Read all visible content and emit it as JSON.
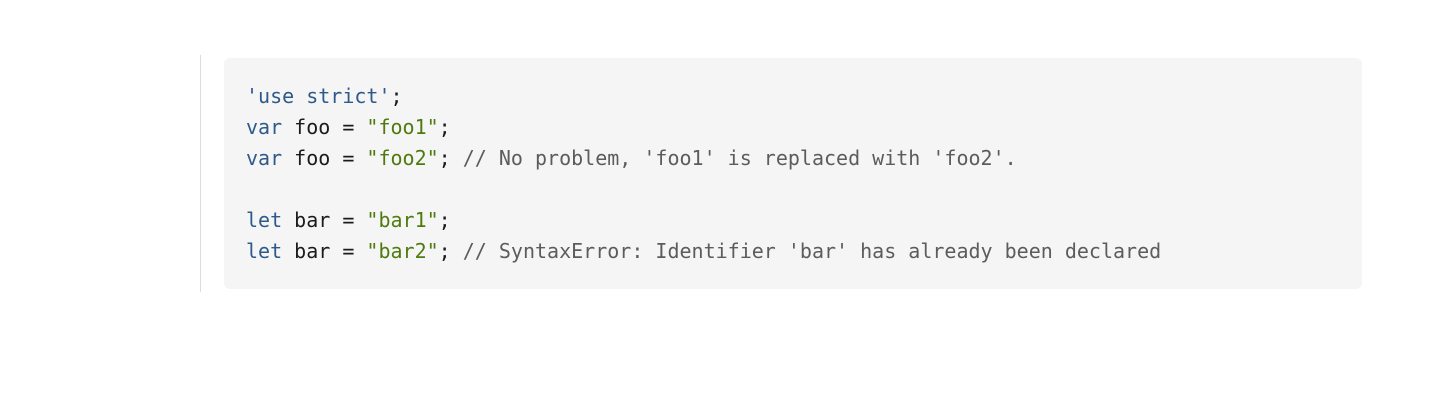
{
  "colors": {
    "background": "#ffffff",
    "code_background": "#f5f5f5",
    "keyword": "#2e5a8a",
    "string": "#4f7a0e",
    "comment": "#5c5c5c",
    "text": "#1b1b1b"
  },
  "code": {
    "lines": [
      [
        {
          "t": "'use strict'",
          "k": "string-single"
        },
        {
          "t": ";",
          "k": "plain"
        }
      ],
      [
        {
          "t": "var",
          "k": "keyword"
        },
        {
          "t": " foo = ",
          "k": "plain"
        },
        {
          "t": "\"foo1\"",
          "k": "string"
        },
        {
          "t": ";",
          "k": "plain"
        }
      ],
      [
        {
          "t": "var",
          "k": "keyword"
        },
        {
          "t": " foo = ",
          "k": "plain"
        },
        {
          "t": "\"foo2\"",
          "k": "string"
        },
        {
          "t": "; ",
          "k": "plain"
        },
        {
          "t": "// No problem, 'foo1' is replaced with 'foo2'.",
          "k": "comment"
        }
      ],
      [],
      [
        {
          "t": "let",
          "k": "keyword"
        },
        {
          "t": " bar = ",
          "k": "plain"
        },
        {
          "t": "\"bar1\"",
          "k": "string"
        },
        {
          "t": ";",
          "k": "plain"
        }
      ],
      [
        {
          "t": "let",
          "k": "keyword"
        },
        {
          "t": " bar = ",
          "k": "plain"
        },
        {
          "t": "\"bar2\"",
          "k": "string"
        },
        {
          "t": "; ",
          "k": "plain"
        },
        {
          "t": "// SyntaxError: Identifier 'bar' has already been declared",
          "k": "comment"
        }
      ]
    ]
  }
}
